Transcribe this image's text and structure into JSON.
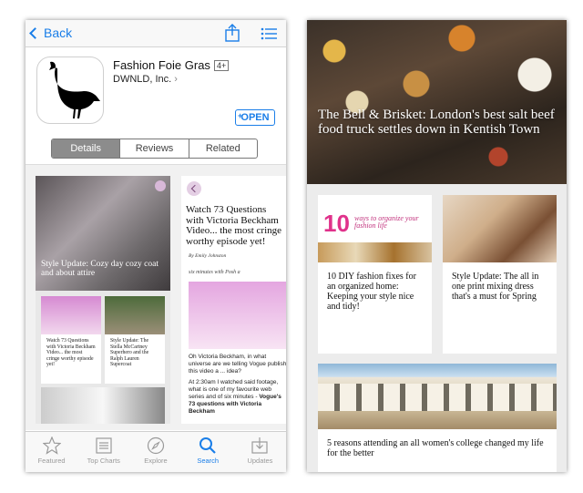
{
  "left": {
    "nav": {
      "back_label": "Back"
    },
    "app": {
      "name": "Fashion Foie Gras",
      "age_rating": "4+",
      "developer": "DWNLD, Inc.",
      "open_label": "OPEN"
    },
    "segments": [
      "Details",
      "Reviews",
      "Related"
    ],
    "screenshot1": {
      "hero_caption": "Style Update: Cozy day cozy coat and about attire",
      "card1": "Watch 73 Questions with Victoria Beckham Video... the most cringe worthy episode yet!",
      "card2": "Style Update: The Stella McCartney Superhero and the Ralph Lauren Supercoat"
    },
    "screenshot2": {
      "title": "Watch 73 Questions with Victoria Beckham Video... the most cringe worthy episode yet!",
      "byline": "By Emily Johnston",
      "quote": "six minutes with Posh a",
      "p1": "Oh Victoria Beckham, in what universe are we telling Vogue publish this video a ... idea?",
      "p2a": "At 2:30am I watched said footage, what is one of my favourite web series and of six minutes - ",
      "p2b": "Vogue's 73 questions with Victoria Beckham"
    },
    "tabs": [
      {
        "label": "Featured",
        "icon": "star-icon"
      },
      {
        "label": "Top Charts",
        "icon": "list-icon"
      },
      {
        "label": "Explore",
        "icon": "compass-icon"
      },
      {
        "label": "Search",
        "icon": "search-icon"
      },
      {
        "label": "Updates",
        "icon": "download-icon"
      }
    ],
    "active_tab": "Search",
    "accent": "#1a7ee8"
  },
  "right": {
    "hero_caption": "The Bell & Brisket: London's best salt beef food truck settles down in Kentish Town",
    "card1": {
      "image_number": "10",
      "image_text": "ways to organize your fashion life",
      "title": "10 DIY fashion fixes for an organized home: Keeping your style nice and tidy!"
    },
    "card2": {
      "title": "Style Update: The all in one print mixing dress that's a must for Spring"
    },
    "card3": {
      "title": "5 reasons attending an all women's college changed my life for the better"
    }
  }
}
